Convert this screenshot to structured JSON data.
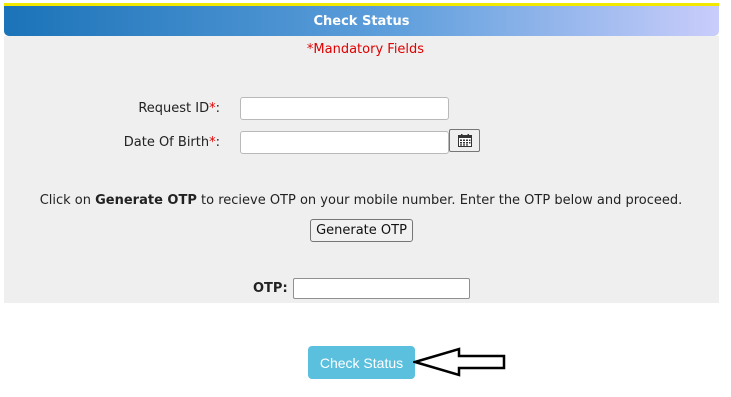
{
  "header": {
    "title": "Check Status"
  },
  "form": {
    "mandatory_note": "*Mandatory Fields",
    "request_id": {
      "label": "Request ID",
      "required_mark": "*",
      "suffix": ":",
      "value": ""
    },
    "dob": {
      "label": "Date Of Birth",
      "required_mark": "*",
      "suffix": ":",
      "value": "",
      "icon": "calendar-icon"
    },
    "instruction": {
      "prefix": "Click on ",
      "bold": "Generate OTP",
      "suffix": " to recieve OTP on your mobile number. Enter the OTP below and proceed."
    },
    "generate_otp_label": "Generate OTP",
    "otp": {
      "label": "OTP",
      "suffix": ":",
      "value": ""
    }
  },
  "actions": {
    "check_status_label": "Check Status",
    "pointer_icon": "left-arrow-icon"
  },
  "colors": {
    "header_start": "#1b73b8",
    "header_end": "#c9cdfb",
    "top_line": "#f3e900",
    "panel_bg": "#efefef",
    "required": "#e00000",
    "check_button": "#5bc0de"
  }
}
